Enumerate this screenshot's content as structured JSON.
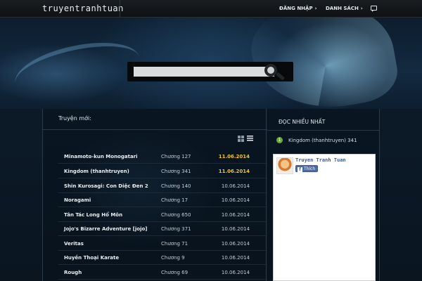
{
  "header": {
    "logo": "truyentranhtuan",
    "nav": [
      {
        "label": "ĐĂNG NHẬP",
        "chevron": "›"
      },
      {
        "label": "DANH SÁCH",
        "chevron": "›"
      }
    ],
    "chat_icon": "chat-bubble-icon"
  },
  "search": {
    "placeholder": "",
    "value": "",
    "icon": "search-icon"
  },
  "latest": {
    "title": "Truyện mới:",
    "view_icons": [
      "grid-view-icon",
      "list-view-icon"
    ],
    "rows": [
      {
        "name": "Minamoto-kun Monogatari",
        "chapter": "Chương 127",
        "date": "11.06.2014",
        "is_new": true
      },
      {
        "name": "Kingdom (thanhtruyen)",
        "chapter": "Chương 341",
        "date": "11.06.2014",
        "is_new": true
      },
      {
        "name": "Shin Kurosagi: Con Diệc Đen 2",
        "chapter": "Chương 140",
        "date": "10.06.2014",
        "is_new": false
      },
      {
        "name": "Noragami",
        "chapter": "Chương 17",
        "date": "10.06.2014",
        "is_new": false
      },
      {
        "name": "Tân Tác Long Hổ Môn",
        "chapter": "Chương 650",
        "date": "10.06.2014",
        "is_new": false
      },
      {
        "name": "Jojo's Bizarre Adventure [jojo]",
        "chapter": "Chương 371",
        "date": "10.06.2014",
        "is_new": false
      },
      {
        "name": "Veritas",
        "chapter": "Chương 71",
        "date": "10.06.2014",
        "is_new": false
      },
      {
        "name": "Huyền Thoại Karate",
        "chapter": "Chương 9",
        "date": "10.06.2014",
        "is_new": false
      },
      {
        "name": "Rough",
        "chapter": "Chương 69",
        "date": "10.06.2014",
        "is_new": false
      }
    ]
  },
  "popular": {
    "title": "ĐỌC NHIỀU NHẤT",
    "items": [
      {
        "rank": "1",
        "name": "Kingdom (thanhtruyen) 341"
      }
    ]
  },
  "facebook": {
    "page_name": "Truyen Tranh Tuan",
    "like_label": "Thích",
    "like_icon": "facebook-f-icon",
    "accent": "#3b5998"
  },
  "colors": {
    "new_date": "#f5c518",
    "rank_badge": "#6aab3a"
  }
}
